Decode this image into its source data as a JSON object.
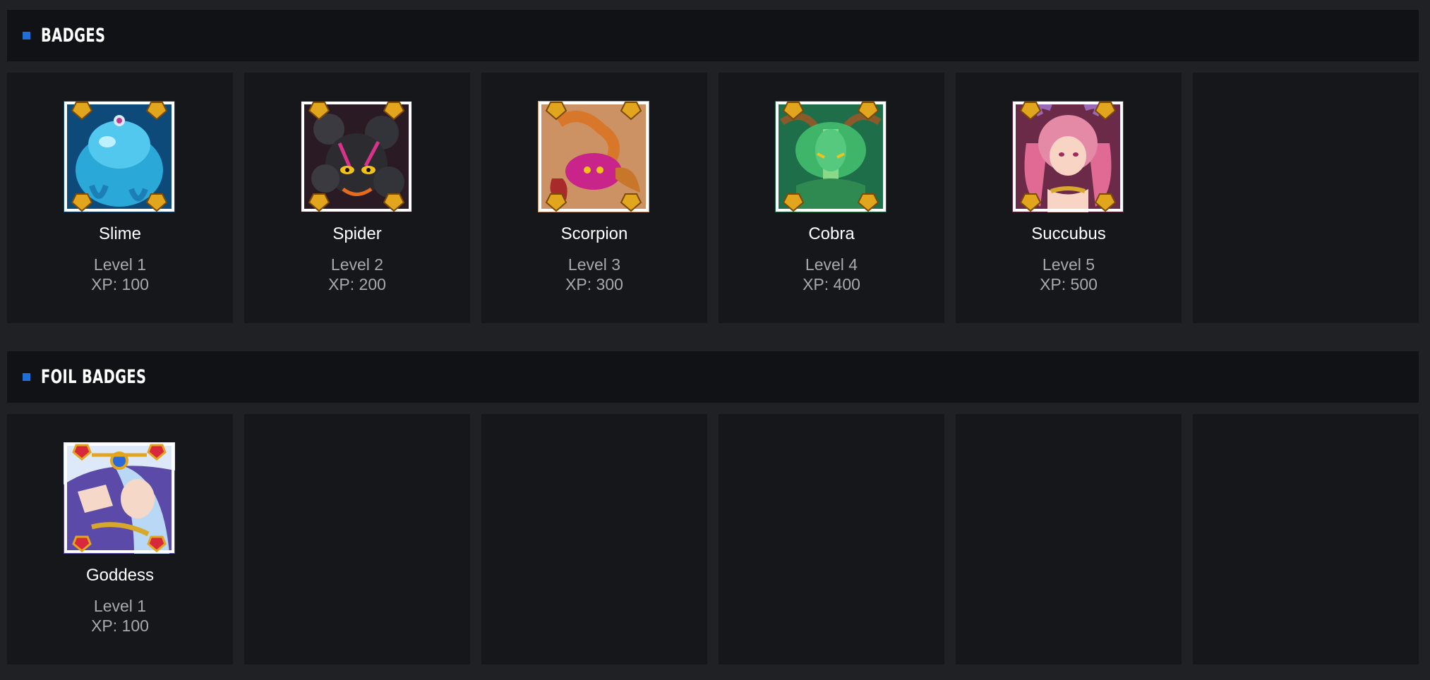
{
  "badges_section": {
    "title": "BADGES",
    "items": [
      {
        "name": "Slime",
        "level": "Level 1",
        "xp": "XP: 100",
        "art": "slime-badge-icon",
        "color": "#2aa8d8"
      },
      {
        "name": "Spider",
        "level": "Level 2",
        "xp": "XP: 200",
        "art": "spider-badge-icon",
        "color": "#2a2a2e"
      },
      {
        "name": "Scorpion",
        "level": "Level 3",
        "xp": "XP: 300",
        "art": "scorpion-badge-icon",
        "color": "#c8248a"
      },
      {
        "name": "Cobra",
        "level": "Level 4",
        "xp": "XP: 400",
        "art": "cobra-badge-icon",
        "color": "#3fb56a"
      },
      {
        "name": "Succubus",
        "level": "Level 5",
        "xp": "XP: 500",
        "art": "succubus-badge-icon",
        "color": "#e48aa6"
      }
    ]
  },
  "foil_section": {
    "title": "FOIL BADGES",
    "items": [
      {
        "name": "Goddess",
        "level": "Level 1",
        "xp": "XP: 100",
        "art": "goddess-badge-icon",
        "color": "#7b5cc9"
      }
    ]
  },
  "colors": {
    "accent": "#1f6fd6",
    "page_background": "#202125",
    "header_background": "#111215",
    "tile_background": "#16171b",
    "gem_gold": "#e2a51e",
    "gem_red": "#d8283c"
  }
}
